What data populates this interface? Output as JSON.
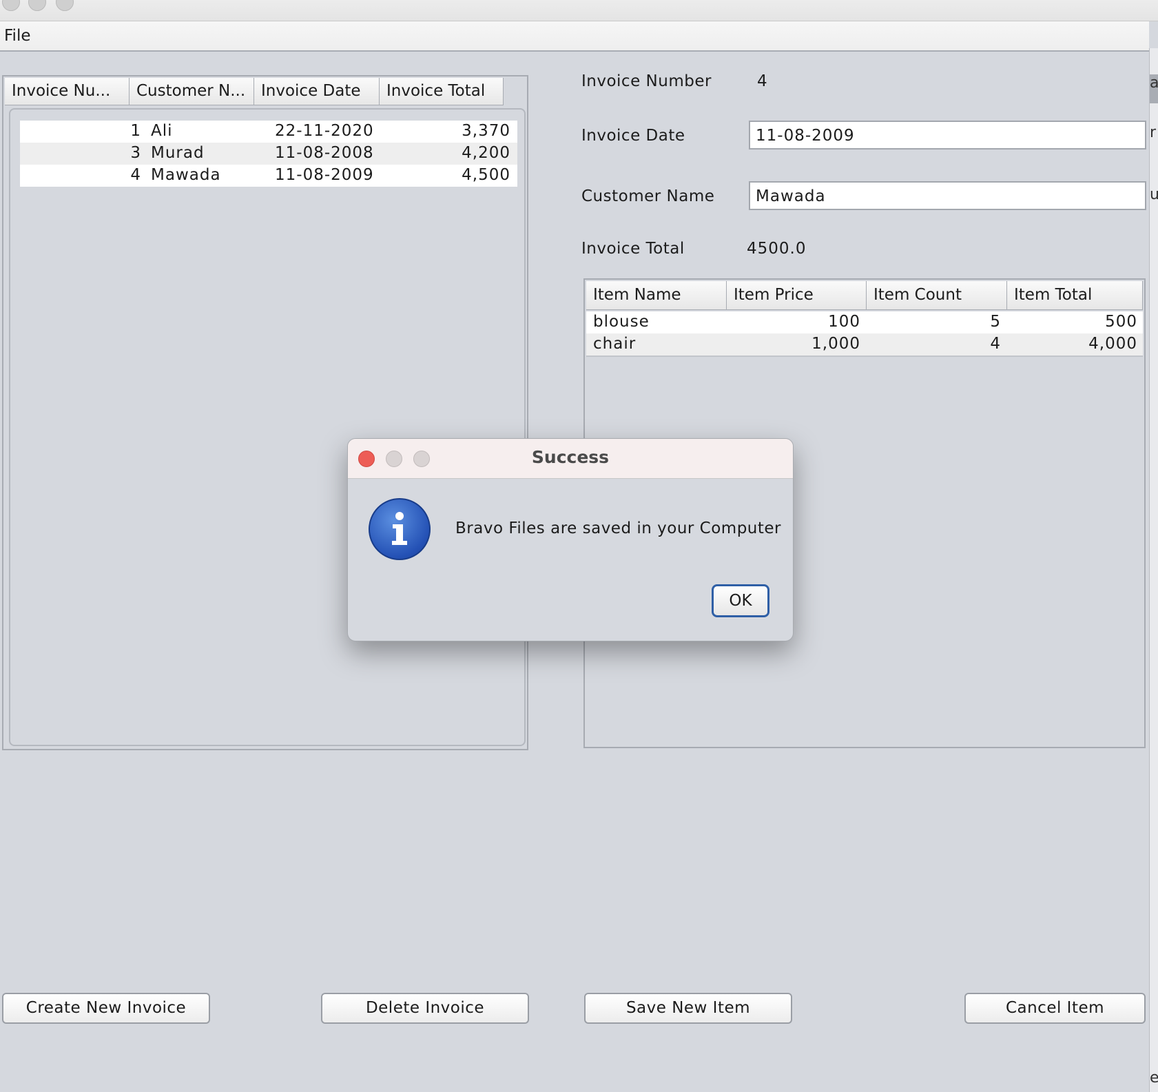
{
  "menu": {
    "file": "File"
  },
  "invoices": {
    "headers": [
      "Invoice Nu...",
      "Customer N...",
      "Invoice Date",
      "Invoice Total"
    ],
    "rows": [
      [
        "1",
        "Ali",
        "22-11-2020",
        "3,370"
      ],
      [
        "3",
        "Murad",
        "11-08-2008",
        "4,200"
      ],
      [
        "4",
        "Mawada",
        "11-08-2009",
        "4,500"
      ]
    ]
  },
  "details": {
    "number_label": "Invoice Number",
    "number_value": "4",
    "date_label": "Invoice Date",
    "date_value": "11-08-2009",
    "customer_label": "Customer Name",
    "customer_value": "Mawada",
    "total_label": "Invoice Total",
    "total_value": "4500.0"
  },
  "items": {
    "headers": [
      "Item Name",
      "Item Price",
      "Item Count",
      "Item Total"
    ],
    "rows": [
      [
        "blouse",
        "100",
        "5",
        "500"
      ],
      [
        "chair",
        "1,000",
        "4",
        "4,000"
      ]
    ]
  },
  "buttons": {
    "create_invoice": "Create New Invoice",
    "delete_invoice": "Delete Invoice",
    "save_item": "Save New Item",
    "cancel_item": "Cancel Item"
  },
  "dialog": {
    "title": "Success",
    "message": "Bravo Files are saved in your Computer",
    "ok": "OK",
    "icon": "info-icon"
  },
  "edge": [
    "a",
    "r",
    "u",
    "e"
  ]
}
